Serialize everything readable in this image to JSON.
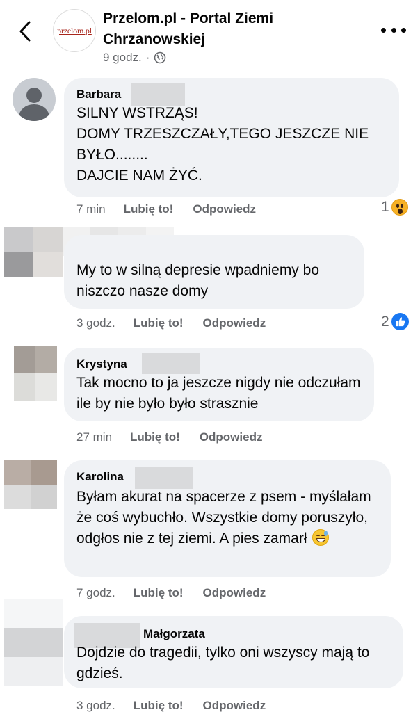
{
  "header": {
    "page_name": "Przelom.pl - Portal Ziemi Chrzanowskiej",
    "logo_text": "przelom.pl",
    "post_time": "9 godz.",
    "visibility_icon": "globe-icon",
    "back_icon": "chevron-left-icon",
    "more_icon": "more-horizontal-icon"
  },
  "actions": {
    "like_label": "Lubię to!",
    "reply_label": "Odpowiedz"
  },
  "comments": [
    {
      "author": "Barbara",
      "text": "SILNY WSTRZĄS!\nDOMY TRZESZCZAŁY,TEGO JESZCZE NIE BYŁO........\nDAJCIE NAM ŻYĆ.",
      "time": "7 min",
      "reaction_count": "1",
      "reaction_icon": "wow-emoji-icon"
    },
    {
      "author": "",
      "text": "My to w silną depresie wpadniemy bo niszczo nasze domy",
      "time": "3 godz.",
      "reaction_count": "2",
      "reaction_icon": "like-reaction-icon"
    },
    {
      "author": "Krystyna",
      "text": "Tak mocno to ja jeszcze nigdy nie odczułam ile by nie było było strasznie",
      "time": "27 min"
    },
    {
      "author": "Karolina",
      "text_main": "Byłam akurat na spacerze z psem - myślałam że coś wybuchło. Wszystkie domy poruszyło, odgłos nie z tej ziemi. A pies zamarł",
      "inline_emoji": "grinning-sweat-emoji-icon",
      "time": "7 godz."
    },
    {
      "author": "Małgorzata",
      "text": "Dojdzie do tragedii, tylko oni wszyscy mają to gdzieś.",
      "time": "3 godz."
    }
  ],
  "colors": {
    "bubble": "#f0f2f5",
    "meta_gray": "#65676b",
    "like_blue": "#1877f2"
  }
}
